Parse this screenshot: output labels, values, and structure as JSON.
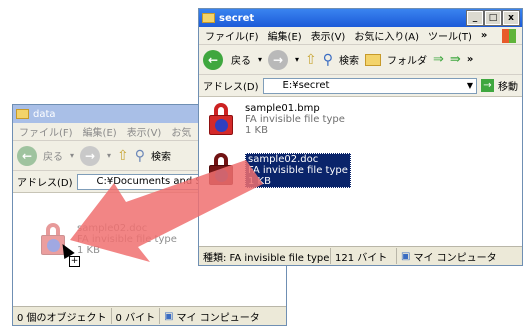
{
  "secret_window": {
    "title": "secret",
    "controls": {
      "min": "_",
      "max": "□",
      "close": "x"
    },
    "menu": [
      "ファイル(F)",
      "編集(E)",
      "表示(V)",
      "お気に入り(A)",
      "ツール(T)",
      "»"
    ],
    "toolbar": {
      "back": "戻る",
      "search": "検索",
      "folders": "フォルダ",
      "more": "»"
    },
    "address": {
      "label": "アドレス(D)",
      "path": "E:¥secret",
      "go": "移動"
    },
    "files": [
      {
        "name": "sample01.bmp",
        "type": "FA invisible file type",
        "size": "1 KB"
      },
      {
        "name": "sample02.doc",
        "type": "FA invisible file type",
        "size": "1 KB"
      }
    ],
    "status": {
      "type": "種類: FA invisible file type 3",
      "bytes": "121 バイト",
      "location": "マイ コンピュータ"
    }
  },
  "data_window": {
    "title": "data",
    "menu": [
      "ファイル(F)",
      "編集(E)",
      "表示(V)",
      "お気"
    ],
    "toolbar": {
      "back": "戻る",
      "search": "検索"
    },
    "address": {
      "label": "アドレス(D)",
      "path": "C:¥Documents and Setti"
    },
    "ghost_file": {
      "name": "sample02.doc",
      "type": "FA invisible file type",
      "size": "1 KB"
    },
    "status": {
      "objects": "0 個のオブジェクト",
      "bytes": "0 バイト",
      "location": "マイ コンピュータ"
    }
  },
  "colors": {
    "arrow": "#f07070",
    "selection": "#0a246a",
    "title_active": "#1c5ad8"
  }
}
